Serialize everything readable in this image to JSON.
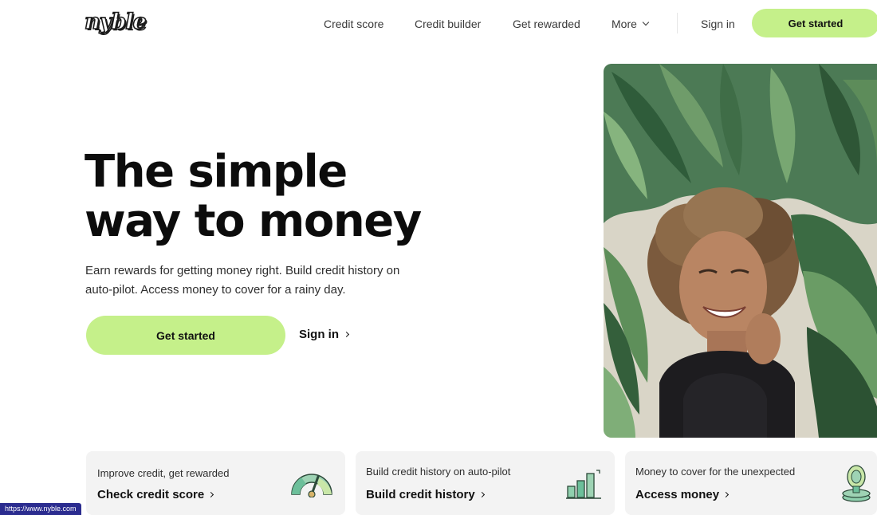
{
  "brand": {
    "logo_text": "nyble"
  },
  "nav": {
    "items": [
      {
        "label": "Credit score"
      },
      {
        "label": "Credit builder"
      },
      {
        "label": "Get rewarded"
      },
      {
        "label": "More"
      }
    ],
    "sign_in": "Sign in",
    "get_started": "Get started"
  },
  "hero": {
    "title_line1": "The simple",
    "title_line2": "way to money",
    "subtitle_line1": "Earn rewards for getting money right. Build credit history on",
    "subtitle_line2": "auto-pilot. Access money to cover for a rainy day.",
    "cta_primary": "Get started",
    "cta_secondary": "Sign in"
  },
  "cards": [
    {
      "label": "Improve credit, get rewarded",
      "link": "Check credit score",
      "icon": "credit-gauge-icon"
    },
    {
      "label": "Build credit history on auto-pilot",
      "link": "Build credit history",
      "icon": "bar-growth-icon"
    },
    {
      "label": "Money to cover for the unexpected",
      "link": "Access money",
      "icon": "coin-stack-icon"
    }
  ],
  "status_bar": {
    "url": "https://www.nyble.com"
  },
  "colors": {
    "accent": "#c5f08a",
    "text": "#111111",
    "card_bg": "#f3f3f3",
    "status_bg": "#2b2c8f"
  }
}
